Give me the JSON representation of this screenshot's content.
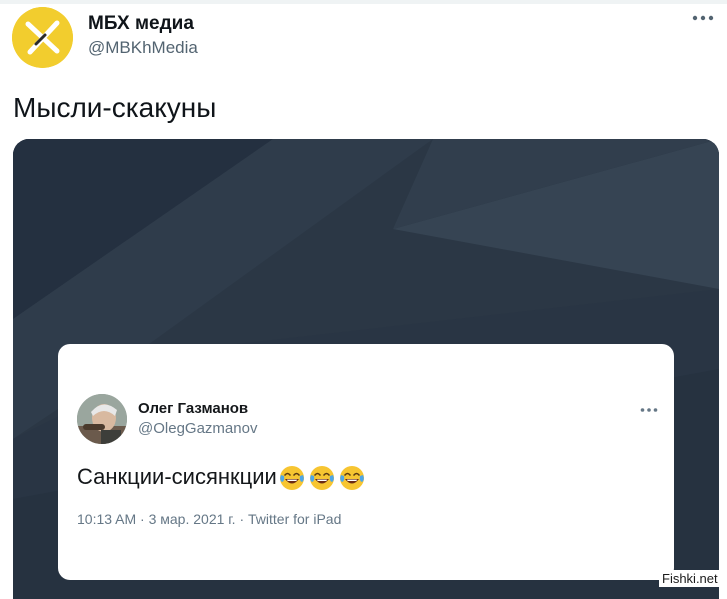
{
  "tweet": {
    "author_name": "МБХ медиа",
    "author_handle": "@MBKhMedia",
    "text": "Мысли-скакуны",
    "avatar_icon": "mbkh-logo-icon",
    "more_icon": "more-options-icon"
  },
  "embedded_tweet": {
    "author_name": "Олег Газманов",
    "author_handle": "@OlegGazmanov",
    "text": "Санкции-сисянкции",
    "emoji_icon": "tears-of-joy-emoji",
    "emoji_count": 3,
    "meta": "10:13 AM · 3 мар. 2021 г. · Twitter for iPad"
  },
  "watermark": "Fishki.net",
  "colors": {
    "avatar_yellow": "#f2cd2e",
    "media_background": "#2b3745",
    "handle_gray": "#536471"
  }
}
